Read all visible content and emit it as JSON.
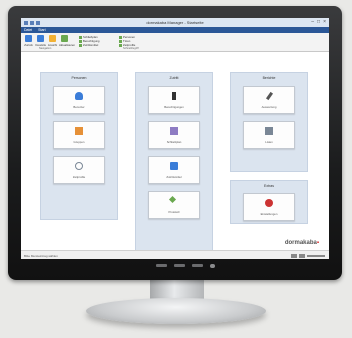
{
  "window": {
    "title": "dormakaba Manager - Startseite"
  },
  "menu": [
    "Datei",
    "Start"
  ],
  "ribbon": {
    "buttons": [
      {
        "label": "Zurück",
        "icon": "back-icon",
        "color": "#3b7dd8"
      },
      {
        "label": "Vorwärts",
        "icon": "forward-icon",
        "color": "#3b7dd8"
      },
      {
        "label": "Ansicht",
        "icon": "view-icon",
        "color": "#f2b134"
      },
      {
        "label": "Aktualisieren",
        "icon": "refresh-icon",
        "color": "#6aa84f"
      }
    ],
    "small_col1": [
      "Schließplan",
      "Berechtigung",
      "Zutrittsmittel"
    ],
    "small_col2": [
      "Personen",
      "Türen",
      "Zeitprofile"
    ],
    "groups": [
      "Navigation",
      "Schnellzugriff"
    ]
  },
  "panels": {
    "personen": {
      "title": "Personen",
      "tiles": [
        {
          "label": "Benutzer",
          "icon": "user-icon",
          "color": "#3b7dd8"
        },
        {
          "label": "Gruppen",
          "icon": "group-icon",
          "color": "#e69138"
        },
        {
          "label": "Zeitprofile",
          "icon": "clock-icon",
          "color": "#7a8796"
        }
      ]
    },
    "zutritt": {
      "title": "Zutritt",
      "tiles": [
        {
          "label": "Berechtigungen",
          "icon": "key-icon",
          "color": "#333333"
        },
        {
          "label": "Schließplan",
          "icon": "plan-icon",
          "color": "#8e7cc3"
        },
        {
          "label": "Zutrittsmittel",
          "icon": "card-icon",
          "color": "#3b7dd8"
        },
        {
          "label": "Protokoll",
          "icon": "log-icon",
          "color": "#6aa84f"
        }
      ]
    },
    "berichte": {
      "title": "Berichte",
      "tiles": [
        {
          "label": "Auswertung",
          "icon": "pen-icon",
          "color": "#555555"
        },
        {
          "label": "Listen",
          "icon": "list-icon",
          "color": "#7a8796"
        }
      ]
    },
    "extras": {
      "title": "Extras",
      "tiles": [
        {
          "label": "Einstellungen",
          "icon": "settings-icon",
          "color": "#cc3333"
        }
      ]
    }
  },
  "status": {
    "text": "Bitte Menüeintrag wählen"
  },
  "brand": {
    "name": "dormakaba",
    "mark": "▪"
  }
}
